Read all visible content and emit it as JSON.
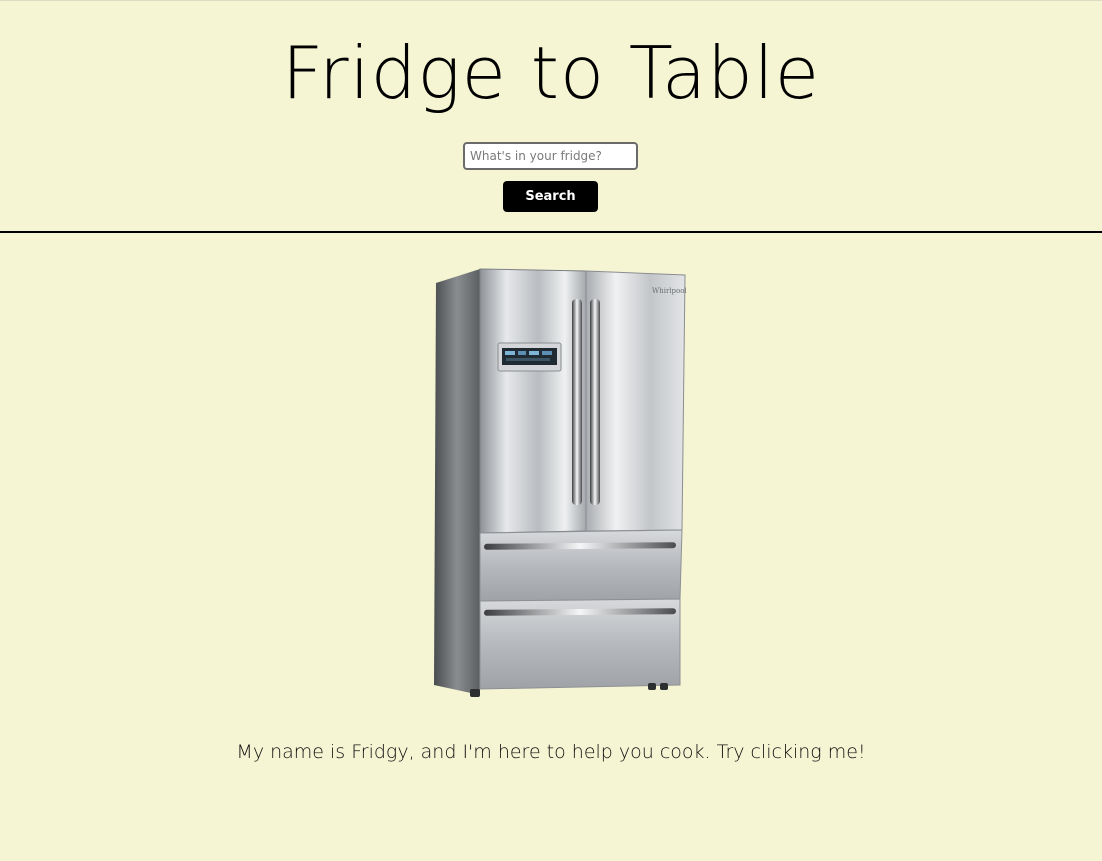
{
  "header": {
    "title": "Fridge to Table",
    "search_placeholder": "What's in your fridge?",
    "search_value": "",
    "search_button_label": "Search"
  },
  "main": {
    "mascot_icon": "refrigerator-icon",
    "caption": "My name is Fridgy, and I'm here to help you cook. Try clicking me!"
  },
  "colors": {
    "background": "#f5f5d3",
    "button": "#000000",
    "divider": "#000000"
  }
}
